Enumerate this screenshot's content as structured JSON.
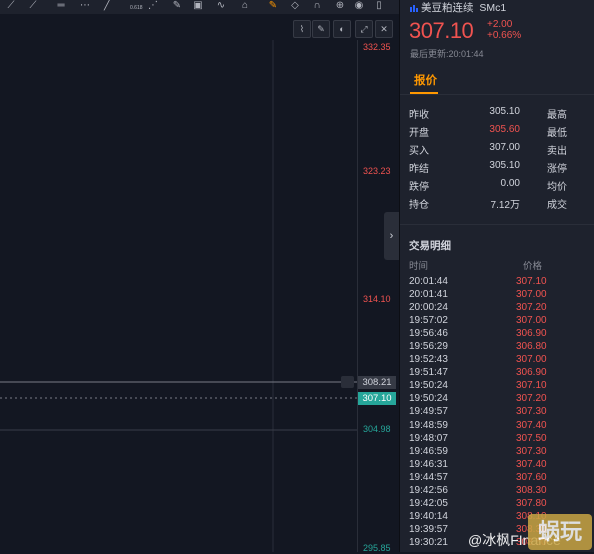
{
  "colors": {
    "up": "#f05350",
    "down": "#26a69a",
    "accent": "#ff9800",
    "muted": "#868993"
  },
  "toolbar": {
    "icons": [
      "line-tool-icon",
      "ray-tool-icon",
      "horizontal-line-icon",
      "pitchfork-icon",
      "fib-icon",
      "gann-icon",
      "brush-icon",
      "image-icon",
      "pattern-icon",
      "lock-icon",
      "eraser-icon",
      "magnet-icon",
      "visibility-icon",
      "trash-icon"
    ],
    "fib_label": "0.618"
  },
  "chart": {
    "price_labels": [
      "332.35",
      "323.23",
      "314.10",
      "304.98",
      "295.85"
    ],
    "crosshair_price": "308.21",
    "last_price": "307.10"
  },
  "header": {
    "symbol_name": "美豆粕连续",
    "symbol_code": "SMc1",
    "price": "307.10",
    "change": "+2.00",
    "change_pct": "+0.66%",
    "updated": "最后更新:20:01:44"
  },
  "tabs": {
    "quote": "报价"
  },
  "quote": {
    "left": [
      {
        "label": "昨收",
        "value": "305.10",
        "color": "#d1d4dc"
      },
      {
        "label": "开盘",
        "value": "305.60",
        "color": "#f05350"
      },
      {
        "label": "买入",
        "value": "307.00",
        "color": "#d1d4dc"
      },
      {
        "label": "昨结",
        "value": "305.10",
        "color": "#d1d4dc"
      },
      {
        "label": "跌停",
        "value": "0.00",
        "color": "#d1d4dc"
      },
      {
        "label": "持仓",
        "value": "7.12万",
        "color": "#d1d4dc"
      }
    ],
    "right": [
      "最高",
      "最低",
      "卖出",
      "涨停",
      "均价",
      "成交"
    ]
  },
  "trades": {
    "title": "交易明细",
    "col_time": "时间",
    "col_price": "价格",
    "rows": [
      {
        "time": "20:01:44",
        "price": "307.10"
      },
      {
        "time": "20:01:41",
        "price": "307.00"
      },
      {
        "time": "20:00:24",
        "price": "307.20"
      },
      {
        "time": "19:57:02",
        "price": "307.00"
      },
      {
        "time": "19:56:46",
        "price": "306.90"
      },
      {
        "time": "19:56:29",
        "price": "306.80"
      },
      {
        "time": "19:52:43",
        "price": "307.00"
      },
      {
        "time": "19:51:47",
        "price": "306.90"
      },
      {
        "time": "19:50:24",
        "price": "307.10"
      },
      {
        "time": "19:50:24",
        "price": "307.20"
      },
      {
        "time": "19:49:57",
        "price": "307.30"
      },
      {
        "time": "19:48:59",
        "price": "307.40"
      },
      {
        "time": "19:48:07",
        "price": "307.50"
      },
      {
        "time": "19:46:59",
        "price": "307.30"
      },
      {
        "time": "19:46:31",
        "price": "307.40"
      },
      {
        "time": "19:44:57",
        "price": "307.60"
      },
      {
        "time": "19:42:56",
        "price": "308.30"
      },
      {
        "time": "19:42:05",
        "price": "307.80"
      },
      {
        "time": "19:40:14",
        "price": "308.10"
      },
      {
        "time": "19:39:57",
        "price": "308.30"
      },
      {
        "time": "19:30:21",
        "price": "308.50"
      }
    ]
  },
  "watermark": {
    "text": "@冰枫FInance",
    "logo": "蜗玩"
  }
}
